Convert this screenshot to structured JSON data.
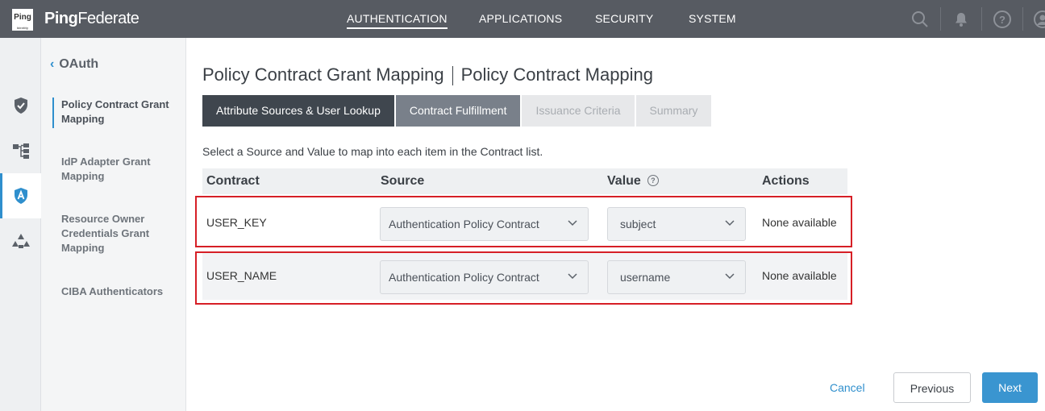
{
  "header": {
    "logo_text": "Ping",
    "logo_subtext": "Identity",
    "brand_prefix": "Ping",
    "brand_suffix": "Federate",
    "nav": [
      {
        "label": "AUTHENTICATION",
        "active": true
      },
      {
        "label": "APPLICATIONS",
        "active": false
      },
      {
        "label": "SECURITY",
        "active": false
      },
      {
        "label": "SYSTEM",
        "active": false
      }
    ],
    "icons": [
      "search-icon",
      "bell-icon",
      "help-icon",
      "user-icon"
    ]
  },
  "rail": {
    "items": [
      "shield-check-icon",
      "hierarchy-icon",
      "oauth-shield-icon",
      "integration-icon"
    ],
    "active_index": 2
  },
  "sidebar": {
    "back_label": "OAuth",
    "items": [
      {
        "label": "Policy Contract Grant Mapping",
        "active": true
      },
      {
        "label": "IdP Adapter Grant Mapping",
        "active": false
      },
      {
        "label": "Resource Owner Credentials Grant Mapping",
        "active": false
      },
      {
        "label": "CIBA Authenticators",
        "active": false
      }
    ]
  },
  "main": {
    "title_primary": "Policy Contract Grant Mapping",
    "title_secondary": "Policy Contract Mapping",
    "tabs": [
      {
        "label": "Attribute Sources & User Lookup",
        "state": "done"
      },
      {
        "label": "Contract Fulfillment",
        "state": "current"
      },
      {
        "label": "Issuance Criteria",
        "state": "pending"
      },
      {
        "label": "Summary",
        "state": "pending"
      }
    ],
    "instructions": "Select a Source and Value to map into each item in the Contract list.",
    "columns": {
      "contract": "Contract",
      "source": "Source",
      "value": "Value",
      "actions": "Actions"
    },
    "rows": [
      {
        "contract": "USER_KEY",
        "source": "Authentication Policy Contract",
        "value": "subject",
        "actions": "None available"
      },
      {
        "contract": "USER_NAME",
        "source": "Authentication Policy Contract",
        "value": "username",
        "actions": "None available"
      }
    ]
  },
  "footer": {
    "cancel": "Cancel",
    "previous": "Previous",
    "next": "Next"
  },
  "colors": {
    "topbar": "#575b62",
    "accent": "#2f8fcd",
    "highlight": "#d61f26",
    "tab_done": "#3f464e",
    "tab_current": "#79808a"
  }
}
